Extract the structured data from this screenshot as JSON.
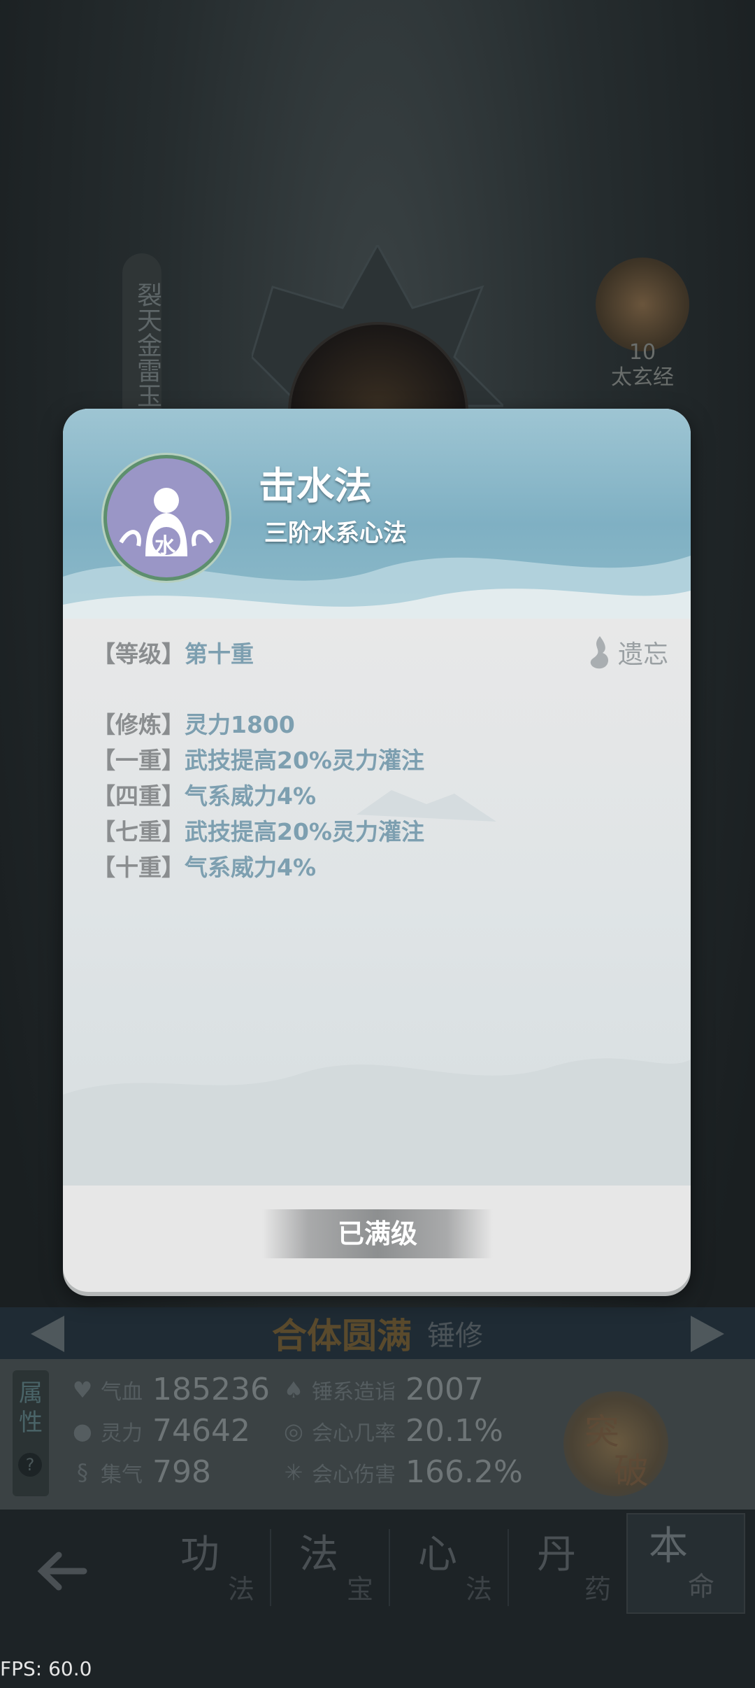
{
  "background": {
    "side_scroll_text": "裂天金雷玉",
    "bg_skill_level": "10",
    "bg_skill_name": "太玄经"
  },
  "dialog": {
    "title": "击水法",
    "subtitle": "三阶水系心法",
    "icon_glyph": "水",
    "level_key": "【等级】",
    "level_value": "第十重",
    "forget_label": "遗忘",
    "attributes": [
      {
        "key": "【修炼】",
        "value": "灵力1800"
      },
      {
        "key": "【一重】",
        "value": "武技提高20%灵力灌注"
      },
      {
        "key": "【四重】",
        "value": "气系威力4%"
      },
      {
        "key": "【七重】",
        "value": "武技提高20%灵力灌注"
      },
      {
        "key": "【十重】",
        "value": "气系威力4%"
      }
    ],
    "max_button": "已满级"
  },
  "level_bar": {
    "realm": "合体圆满",
    "sub": "锤修"
  },
  "stats": {
    "tag": "属性",
    "help": "?",
    "items": [
      {
        "icon": "heart-icon",
        "label": "气血",
        "value": "185236"
      },
      {
        "icon": "drop-icon",
        "label": "灵力",
        "value": "74642"
      },
      {
        "icon": "swirl-icon",
        "label": "集气",
        "value": "798"
      },
      {
        "icon": "hammer-icon",
        "label": "锤系造诣",
        "value": "2007"
      },
      {
        "icon": "crit-icon",
        "label": "会心几率",
        "value": "20.1%"
      },
      {
        "icon": "burst-icon",
        "label": "会心伤害",
        "value": "166.2%"
      }
    ],
    "breakthrough_1": "突",
    "breakthrough_2": "破"
  },
  "nav": {
    "items": [
      {
        "big": "功",
        "small": "法"
      },
      {
        "big": "法",
        "small": "宝"
      },
      {
        "big": "心",
        "small": "法"
      },
      {
        "big": "丹",
        "small": "药"
      },
      {
        "big": "本",
        "small": "命"
      }
    ]
  },
  "fps": "FPS: 60.0",
  "colors": {
    "accent_blue": "#7d9fb0",
    "header_blue": "#7fb0c3",
    "icon_purple": "#9a96c6",
    "realm_gold": "#5a4a2c"
  }
}
